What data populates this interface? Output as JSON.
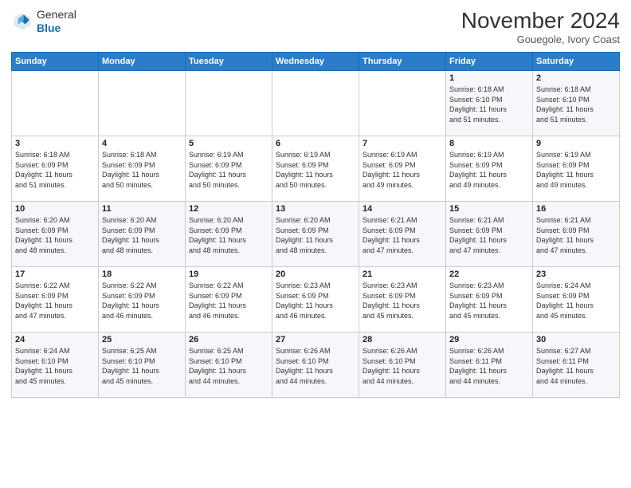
{
  "header": {
    "logo_general": "General",
    "logo_blue": "Blue",
    "month_title": "November 2024",
    "location": "Gouegole, Ivory Coast"
  },
  "weekdays": [
    "Sunday",
    "Monday",
    "Tuesday",
    "Wednesday",
    "Thursday",
    "Friday",
    "Saturday"
  ],
  "weeks": [
    [
      {
        "day": "",
        "info": ""
      },
      {
        "day": "",
        "info": ""
      },
      {
        "day": "",
        "info": ""
      },
      {
        "day": "",
        "info": ""
      },
      {
        "day": "",
        "info": ""
      },
      {
        "day": "1",
        "info": "Sunrise: 6:18 AM\nSunset: 6:10 PM\nDaylight: 11 hours\nand 51 minutes."
      },
      {
        "day": "2",
        "info": "Sunrise: 6:18 AM\nSunset: 6:10 PM\nDaylight: 11 hours\nand 51 minutes."
      }
    ],
    [
      {
        "day": "3",
        "info": "Sunrise: 6:18 AM\nSunset: 6:09 PM\nDaylight: 11 hours\nand 51 minutes."
      },
      {
        "day": "4",
        "info": "Sunrise: 6:18 AM\nSunset: 6:09 PM\nDaylight: 11 hours\nand 50 minutes."
      },
      {
        "day": "5",
        "info": "Sunrise: 6:19 AM\nSunset: 6:09 PM\nDaylight: 11 hours\nand 50 minutes."
      },
      {
        "day": "6",
        "info": "Sunrise: 6:19 AM\nSunset: 6:09 PM\nDaylight: 11 hours\nand 50 minutes."
      },
      {
        "day": "7",
        "info": "Sunrise: 6:19 AM\nSunset: 6:09 PM\nDaylight: 11 hours\nand 49 minutes."
      },
      {
        "day": "8",
        "info": "Sunrise: 6:19 AM\nSunset: 6:09 PM\nDaylight: 11 hours\nand 49 minutes."
      },
      {
        "day": "9",
        "info": "Sunrise: 6:19 AM\nSunset: 6:09 PM\nDaylight: 11 hours\nand 49 minutes."
      }
    ],
    [
      {
        "day": "10",
        "info": "Sunrise: 6:20 AM\nSunset: 6:09 PM\nDaylight: 11 hours\nand 48 minutes."
      },
      {
        "day": "11",
        "info": "Sunrise: 6:20 AM\nSunset: 6:09 PM\nDaylight: 11 hours\nand 48 minutes."
      },
      {
        "day": "12",
        "info": "Sunrise: 6:20 AM\nSunset: 6:09 PM\nDaylight: 11 hours\nand 48 minutes."
      },
      {
        "day": "13",
        "info": "Sunrise: 6:20 AM\nSunset: 6:09 PM\nDaylight: 11 hours\nand 48 minutes."
      },
      {
        "day": "14",
        "info": "Sunrise: 6:21 AM\nSunset: 6:09 PM\nDaylight: 11 hours\nand 47 minutes."
      },
      {
        "day": "15",
        "info": "Sunrise: 6:21 AM\nSunset: 6:09 PM\nDaylight: 11 hours\nand 47 minutes."
      },
      {
        "day": "16",
        "info": "Sunrise: 6:21 AM\nSunset: 6:09 PM\nDaylight: 11 hours\nand 47 minutes."
      }
    ],
    [
      {
        "day": "17",
        "info": "Sunrise: 6:22 AM\nSunset: 6:09 PM\nDaylight: 11 hours\nand 47 minutes."
      },
      {
        "day": "18",
        "info": "Sunrise: 6:22 AM\nSunset: 6:09 PM\nDaylight: 11 hours\nand 46 minutes."
      },
      {
        "day": "19",
        "info": "Sunrise: 6:22 AM\nSunset: 6:09 PM\nDaylight: 11 hours\nand 46 minutes."
      },
      {
        "day": "20",
        "info": "Sunrise: 6:23 AM\nSunset: 6:09 PM\nDaylight: 11 hours\nand 46 minutes."
      },
      {
        "day": "21",
        "info": "Sunrise: 6:23 AM\nSunset: 6:09 PM\nDaylight: 11 hours\nand 45 minutes."
      },
      {
        "day": "22",
        "info": "Sunrise: 6:23 AM\nSunset: 6:09 PM\nDaylight: 11 hours\nand 45 minutes."
      },
      {
        "day": "23",
        "info": "Sunrise: 6:24 AM\nSunset: 6:09 PM\nDaylight: 11 hours\nand 45 minutes."
      }
    ],
    [
      {
        "day": "24",
        "info": "Sunrise: 6:24 AM\nSunset: 6:10 PM\nDaylight: 11 hours\nand 45 minutes."
      },
      {
        "day": "25",
        "info": "Sunrise: 6:25 AM\nSunset: 6:10 PM\nDaylight: 11 hours\nand 45 minutes."
      },
      {
        "day": "26",
        "info": "Sunrise: 6:25 AM\nSunset: 6:10 PM\nDaylight: 11 hours\nand 44 minutes."
      },
      {
        "day": "27",
        "info": "Sunrise: 6:26 AM\nSunset: 6:10 PM\nDaylight: 11 hours\nand 44 minutes."
      },
      {
        "day": "28",
        "info": "Sunrise: 6:26 AM\nSunset: 6:10 PM\nDaylight: 11 hours\nand 44 minutes."
      },
      {
        "day": "29",
        "info": "Sunrise: 6:26 AM\nSunset: 6:11 PM\nDaylight: 11 hours\nand 44 minutes."
      },
      {
        "day": "30",
        "info": "Sunrise: 6:27 AM\nSunset: 6:11 PM\nDaylight: 11 hours\nand 44 minutes."
      }
    ]
  ]
}
